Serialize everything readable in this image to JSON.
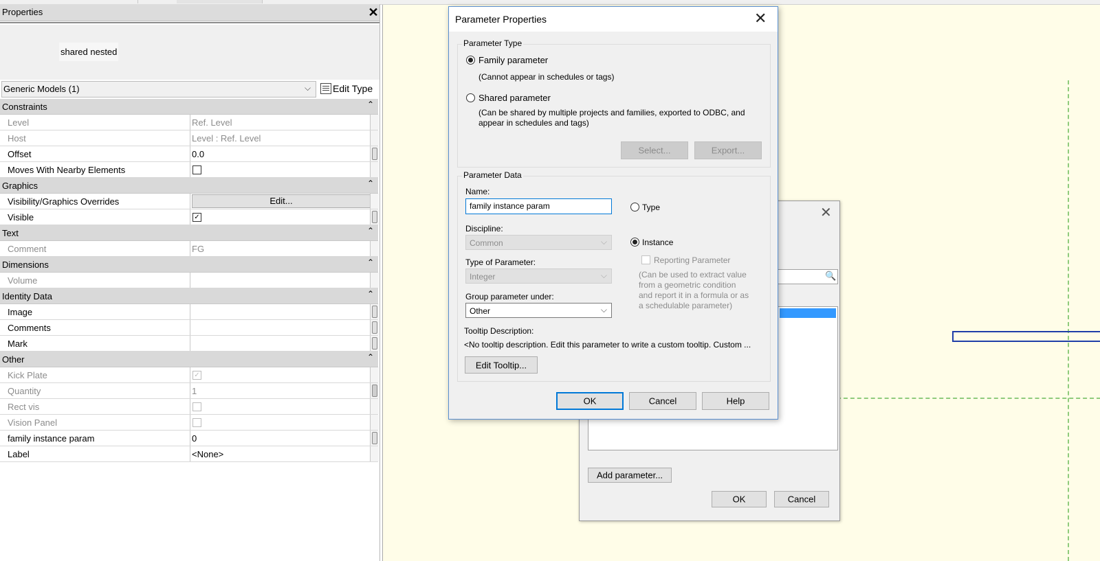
{
  "properties_panel": {
    "title": "Properties",
    "close_glyph": "✕",
    "preview_label": "shared nested",
    "type_selector": "Generic Models (1)",
    "edit_type_label": "Edit Type",
    "groups": {
      "constraints": "Constraints",
      "graphics": "Graphics",
      "text": "Text",
      "dimensions": "Dimensions",
      "identity": "Identity Data",
      "other": "Other"
    },
    "rows": {
      "level": {
        "name": "Level",
        "value": "Ref. Level"
      },
      "host": {
        "name": "Host",
        "value": "Level : Ref. Level"
      },
      "offset": {
        "name": "Offset",
        "value": "0.0"
      },
      "moves": {
        "name": "Moves With Nearby Elements"
      },
      "visgraph": {
        "name": "Visibility/Graphics Overrides",
        "button": "Edit..."
      },
      "visible": {
        "name": "Visible"
      },
      "comment": {
        "name": "Comment",
        "value": "FG"
      },
      "volume": {
        "name": "Volume",
        "value": ""
      },
      "image": {
        "name": "Image",
        "value": ""
      },
      "comments": {
        "name": "Comments",
        "value": ""
      },
      "mark": {
        "name": "Mark",
        "value": ""
      },
      "kickplate": {
        "name": "Kick Plate"
      },
      "quantity": {
        "name": "Quantity",
        "value": "1"
      },
      "rectvis": {
        "name": "Rect vis"
      },
      "visionpanel": {
        "name": "Vision Panel"
      },
      "famparam": {
        "name": "family instance param",
        "value": "0"
      },
      "label": {
        "name": "Label",
        "value": "<None>"
      }
    },
    "checked_mark": "✓"
  },
  "param_dialog": {
    "title": "Parameter Properties",
    "close_glyph": "✕",
    "parameter_type_legend": "Parameter Type",
    "family_parameter": "Family parameter",
    "family_note": "(Cannot appear in schedules or tags)",
    "shared_parameter": "Shared parameter",
    "shared_note_1": "(Can be shared by multiple projects and families, exported to ODBC, and",
    "shared_note_2": "appear in schedules and tags)",
    "select_button": "Select...",
    "export_button": "Export...",
    "parameter_data_legend": "Parameter Data",
    "name_label": "Name:",
    "name_value": "family instance param",
    "type_radio": "Type",
    "discipline_label": "Discipline:",
    "discipline_value": "Common",
    "instance_radio": "Instance",
    "type_of_parameter_label": "Type of Parameter:",
    "type_of_parameter_value": "Integer",
    "reporting_parameter": "Reporting Parameter",
    "reporting_note_1": "(Can be used to extract value",
    "reporting_note_2": "from a geometric condition",
    "reporting_note_3": "and report it in a formula or as",
    "reporting_note_4": "a schedulable parameter)",
    "group_under_label": "Group parameter under:",
    "group_under_value": "Other",
    "tooltip_label": "Tooltip Description:",
    "tooltip_text": "<No tooltip description. Edit this parameter to write a custom tooltip. Custom ...",
    "edit_tooltip_button": "Edit Tooltip...",
    "ok_button": "OK",
    "cancel_button": "Cancel",
    "help_button": "Help"
  },
  "back_dialog": {
    "close_glyph": "✕",
    "search_icon": "🔍",
    "add_parameter_button": "Add parameter...",
    "ok_button": "OK",
    "cancel_button": "Cancel"
  },
  "icons": {
    "chevron_down": "⌵",
    "collapse": "⌃"
  },
  "colors": {
    "canvas_bg": "#fffde8",
    "ref_plane": "#8fcb7c",
    "selection": "#3399ff",
    "element_outline": "#1f3ea8"
  }
}
